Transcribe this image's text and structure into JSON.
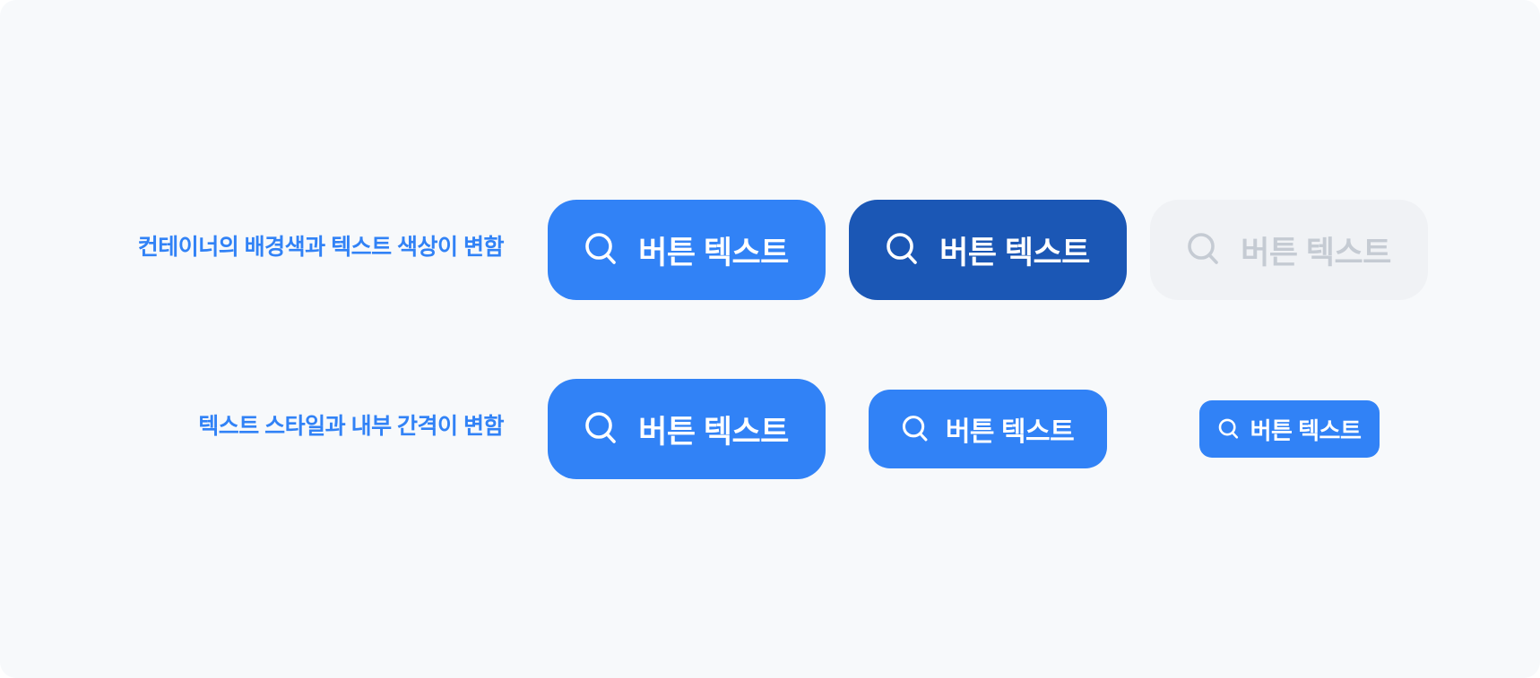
{
  "rows": [
    {
      "label": "컨테이너의 배경색과 텍스트 색상이 변함",
      "buttons": [
        {
          "label": "버튼 텍스트",
          "state": "default",
          "icon": "search-icon"
        },
        {
          "label": "버튼 텍스트",
          "state": "pressed",
          "icon": "search-icon"
        },
        {
          "label": "버튼 텍스트",
          "state": "disabled",
          "icon": "search-icon"
        }
      ]
    },
    {
      "label": "텍스트 스타일과 내부 간격이 변함",
      "buttons": [
        {
          "label": "버튼 텍스트",
          "size": "large",
          "icon": "search-icon"
        },
        {
          "label": "버튼 텍스트",
          "size": "medium",
          "icon": "search-icon"
        },
        {
          "label": "버튼 텍스트",
          "size": "small",
          "icon": "search-icon"
        }
      ]
    }
  ],
  "colors": {
    "label_blue": "#3182f6",
    "primary": "#3182f6",
    "pressed": "#1b57b5",
    "disabled_bg": "#f0f2f5",
    "disabled_text": "#c5cbd3",
    "canvas_bg": "#f7f9fb"
  }
}
